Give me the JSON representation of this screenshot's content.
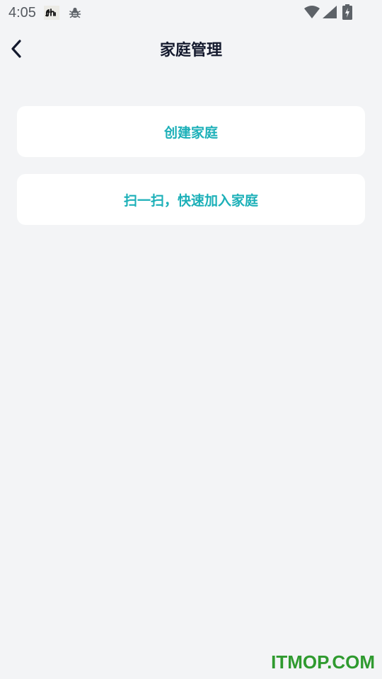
{
  "status_bar": {
    "time": "4:05",
    "icons": [
      "app-notification-icon",
      "bug-icon",
      "wifi-icon",
      "signal-icon",
      "battery-icon"
    ]
  },
  "header": {
    "title": "家庭管理",
    "back_icon": "chevron-left-icon"
  },
  "actions": [
    {
      "label": "创建家庭"
    },
    {
      "label": "扫一扫，快速加入家庭"
    }
  ],
  "watermark": "ITMOP.COM",
  "colors": {
    "background": "#f3f4f6",
    "card": "#ffffff",
    "accent": "#1cb0b8",
    "title": "#141a2e",
    "watermark": "#2f9a2f"
  }
}
